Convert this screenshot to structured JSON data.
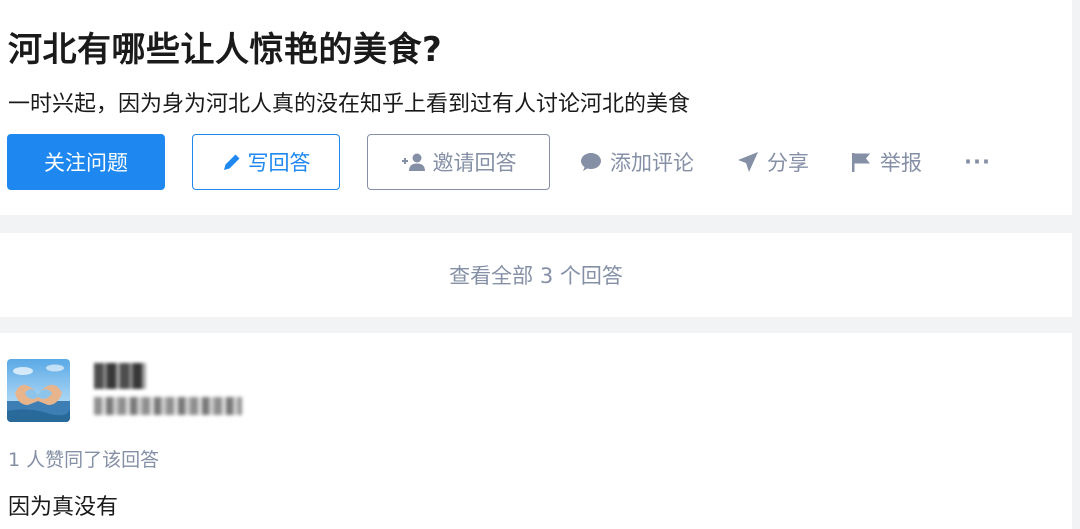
{
  "question": {
    "title": "河北有哪些让人惊艳的美食?",
    "detail": "一时兴起，因为身为河北人真的没在知乎上看到过有人讨论河北的美食"
  },
  "actions": {
    "follow_label": "关注问题",
    "write_label": "写回答",
    "invite_label": "邀请回答",
    "comment_label": "添加评论",
    "share_label": "分享",
    "report_label": "举报",
    "more_label": "···"
  },
  "view_all": {
    "label": "查看全部 3 个回答"
  },
  "answer": {
    "vote_text": "1 人赞同了该回答",
    "content": "因为真没有"
  },
  "colors": {
    "accent": "#1e88f0",
    "secondary_text": "#8590a6",
    "page_background": "#f2f3f5"
  },
  "icons": [
    "pencil-icon",
    "add-person-icon",
    "comment-bubble-icon",
    "paper-plane-icon",
    "flag-icon"
  ]
}
